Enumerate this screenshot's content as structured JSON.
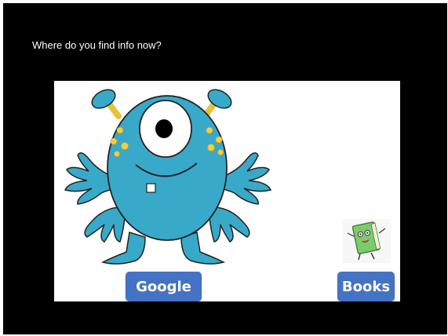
{
  "slide": {
    "question": "Where do you find info now?",
    "background_color": "#000000",
    "panel_color": "#ffffff",
    "accent_color": "#4472c4"
  },
  "choices": {
    "google_label": "Google",
    "books_label": "Books"
  },
  "illustrations": {
    "monster": "one-eyed-blue-monster-illustration",
    "book": "green-book-character-icon"
  }
}
